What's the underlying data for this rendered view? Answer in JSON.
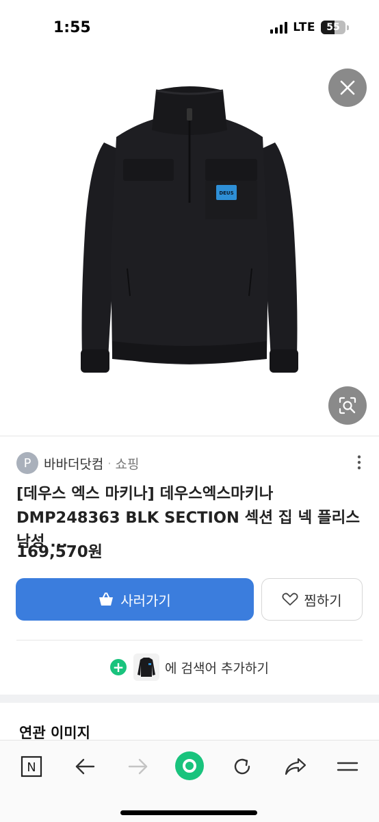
{
  "status_bar": {
    "time": "1:55",
    "network": "LTE",
    "battery_level": "55",
    "battery_percent": 55
  },
  "image_viewer": {
    "close_icon": "close-icon",
    "lens_icon": "image-search-icon",
    "jacket_logo": "DEUS"
  },
  "seller": {
    "avatar_letter": "P",
    "name": "바바더닷컴",
    "separator": "·",
    "type": "쇼핑"
  },
  "product": {
    "title": "[데우스 엑스 마키나] 데우스엑스마키나 DMP248363 BLK SECTION 섹션 집 넥 플리스 남성 ...",
    "price": "169,570원"
  },
  "actions": {
    "buy_label": "사러가기",
    "wish_label": "찜하기"
  },
  "add_search": {
    "plus": "+",
    "label": "에 검색어 추가하기"
  },
  "related": {
    "title": "연관 이미지"
  },
  "bottom_nav": {
    "items": [
      "naver-home-icon",
      "back-arrow-icon",
      "forward-arrow-icon",
      "green-dot-icon",
      "refresh-icon",
      "share-icon",
      "menu-icon"
    ],
    "naver_letter": "N"
  },
  "colors": {
    "accent_blue": "#3b7ddd",
    "green": "#19c37d",
    "button_gray": "#8a8a8a"
  }
}
